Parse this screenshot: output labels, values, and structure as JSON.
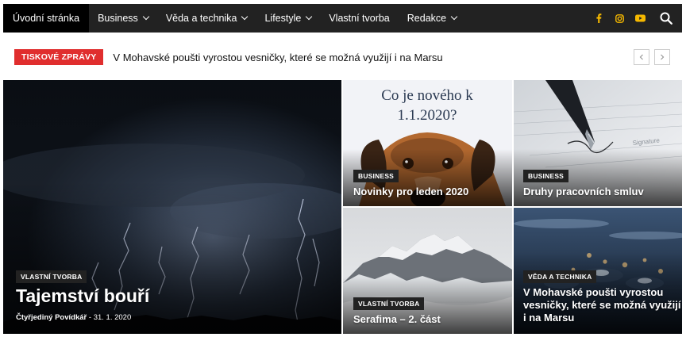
{
  "nav": {
    "items": [
      {
        "label": "Úvodní stránka",
        "dropdown": false,
        "active": true
      },
      {
        "label": "Business",
        "dropdown": true
      },
      {
        "label": "Věda a technika",
        "dropdown": true
      },
      {
        "label": "Lifestyle",
        "dropdown": true
      },
      {
        "label": "Vlastní tvorba",
        "dropdown": false
      },
      {
        "label": "Redakce",
        "dropdown": true
      }
    ],
    "social_icons": [
      "facebook-icon",
      "instagram-icon",
      "youtube-icon"
    ],
    "accent_color": "#f5b800"
  },
  "ticker": {
    "label": "TISKOVÉ ZPRÁVY",
    "headline": "V Mohavské poušti vyrostou vesničky, které se možná využijí i na Marsu",
    "label_color": "#e02e2e"
  },
  "featured": {
    "main": {
      "category": "VLASTNÍ TVORBA",
      "title": "Tajemství bouří",
      "author": "Čtyřjediný Povídkář",
      "separator": "-",
      "date": "31. 1. 2020"
    },
    "tile1": {
      "category": "BUSINESS",
      "title": "Novinky pro leden 2020",
      "image_text_line1": "Co je nového k",
      "image_text_line2": "1.1.2020?"
    },
    "tile2": {
      "category": "BUSINESS",
      "title": "Druhy pracovních smluv",
      "image_text": "Signature"
    },
    "tile3": {
      "category": "VLASTNÍ TVORBA",
      "title": "Serafima – 2. část"
    },
    "tile4": {
      "category": "VĚDA A TECHNIKA",
      "title_line1": "V Mohavské poušti vyrostou",
      "title_line2": "vesničky, které se možná využijí",
      "title_line3": "i na Marsu"
    }
  }
}
